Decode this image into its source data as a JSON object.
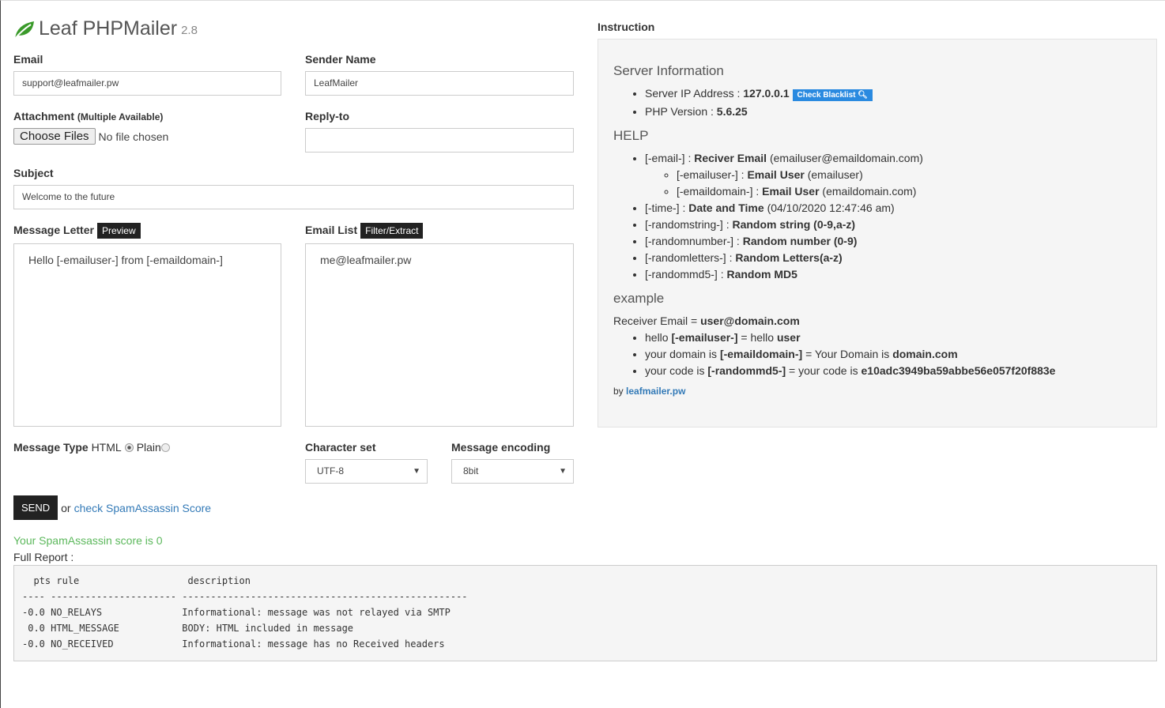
{
  "app": {
    "name": "Leaf PHPMailer",
    "version": "2.8"
  },
  "form": {
    "email_label": "Email",
    "email_value": "support@leafmailer.pw",
    "sender_label": "Sender Name",
    "sender_value": "LeafMailer",
    "attachment_label": "Attachment",
    "attachment_note": "(Multiple Available)",
    "choose_files": "Choose Files",
    "no_file": "No file chosen",
    "replyto_label": "Reply-to",
    "replyto_value": "",
    "subject_label": "Subject",
    "subject_value": "Welcome to the future",
    "message_label": "Message Letter",
    "preview": "Preview",
    "message_value": "Hello [-emailuser-] from [-emaildomain-]",
    "list_label": "Email List",
    "filter": "Filter/Extract",
    "list_value": "me@leafmailer.pw",
    "type_label": "Message Type",
    "type_html": "HTML",
    "type_plain": "Plain",
    "type_selected": "HTML",
    "charset_label": "Character set",
    "charset_value": "UTF-8",
    "encoding_label": "Message encoding",
    "encoding_value": "8bit",
    "send": "SEND",
    "or": "or",
    "check_spam": "check SpamAssassin Score",
    "score_text": "Your SpamAssassin score is 0",
    "full_report": "Full Report :"
  },
  "report": {
    "lines": [
      "  pts rule                   description",
      "---- ---------------------- --------------------------------------------------",
      "-0.0 NO_RELAYS              Informational: message was not relayed via SMTP",
      " 0.0 HTML_MESSAGE           BODY: HTML included in message",
      "-0.0 NO_RECEIVED            Informational: message has no Received headers"
    ]
  },
  "instruction": {
    "title": "Instruction",
    "server_title": "Server Information",
    "ip_label": "Server IP Address :",
    "ip": "127.0.0.1",
    "check_blacklist": "Check Blacklist",
    "php_label": "PHP Version :",
    "php": "5.6.25",
    "help_title": "HELP",
    "help": [
      {
        "tag": "[-email-] :",
        "name": "Reciver Email",
        "desc": "(emailuser@emaildomain.com)",
        "sub": false
      },
      {
        "tag": "[-emailuser-] :",
        "name": "Email User",
        "desc": "(emailuser)",
        "sub": true
      },
      {
        "tag": "[-emaildomain-] :",
        "name": "Email User",
        "desc": "(emaildomain.com)",
        "sub": true
      },
      {
        "tag": "[-time-] :",
        "name": "Date and Time",
        "desc": "(04/10/2020 12:47:46 am)",
        "sub": false
      },
      {
        "tag": "[-randomstring-] :",
        "name": "Random string (0-9,a-z)",
        "desc": "",
        "sub": false
      },
      {
        "tag": "[-randomnumber-] :",
        "name": "Random number (0-9)",
        "desc": "",
        "sub": false
      },
      {
        "tag": "[-randomletters-] :",
        "name": "Random Letters(a-z)",
        "desc": "",
        "sub": false
      },
      {
        "tag": "[-randommd5-] :",
        "name": "Random MD5",
        "desc": "",
        "sub": false
      }
    ],
    "example_title": "example",
    "receiver_label": "Receiver Email =",
    "receiver": "user@domain.com",
    "examples": [
      {
        "a": "hello",
        "b": "[-emailuser-]",
        "c": "= hello",
        "d": "user"
      },
      {
        "a": "your domain is",
        "b": "[-emaildomain-]",
        "c": "= Your Domain is",
        "d": "domain.com"
      },
      {
        "a": "your code is",
        "b": "[-randommd5-]",
        "c": "= your code is",
        "d": "e10adc3949ba59abbe56e057f20f883e"
      }
    ],
    "by": "by",
    "by_link": "leafmailer.pw"
  },
  "colors": {
    "leaf": "#3a9a2a",
    "blue_button": "#2a8ae0",
    "score_green": "#5cb85c",
    "link": "#337ab7"
  }
}
